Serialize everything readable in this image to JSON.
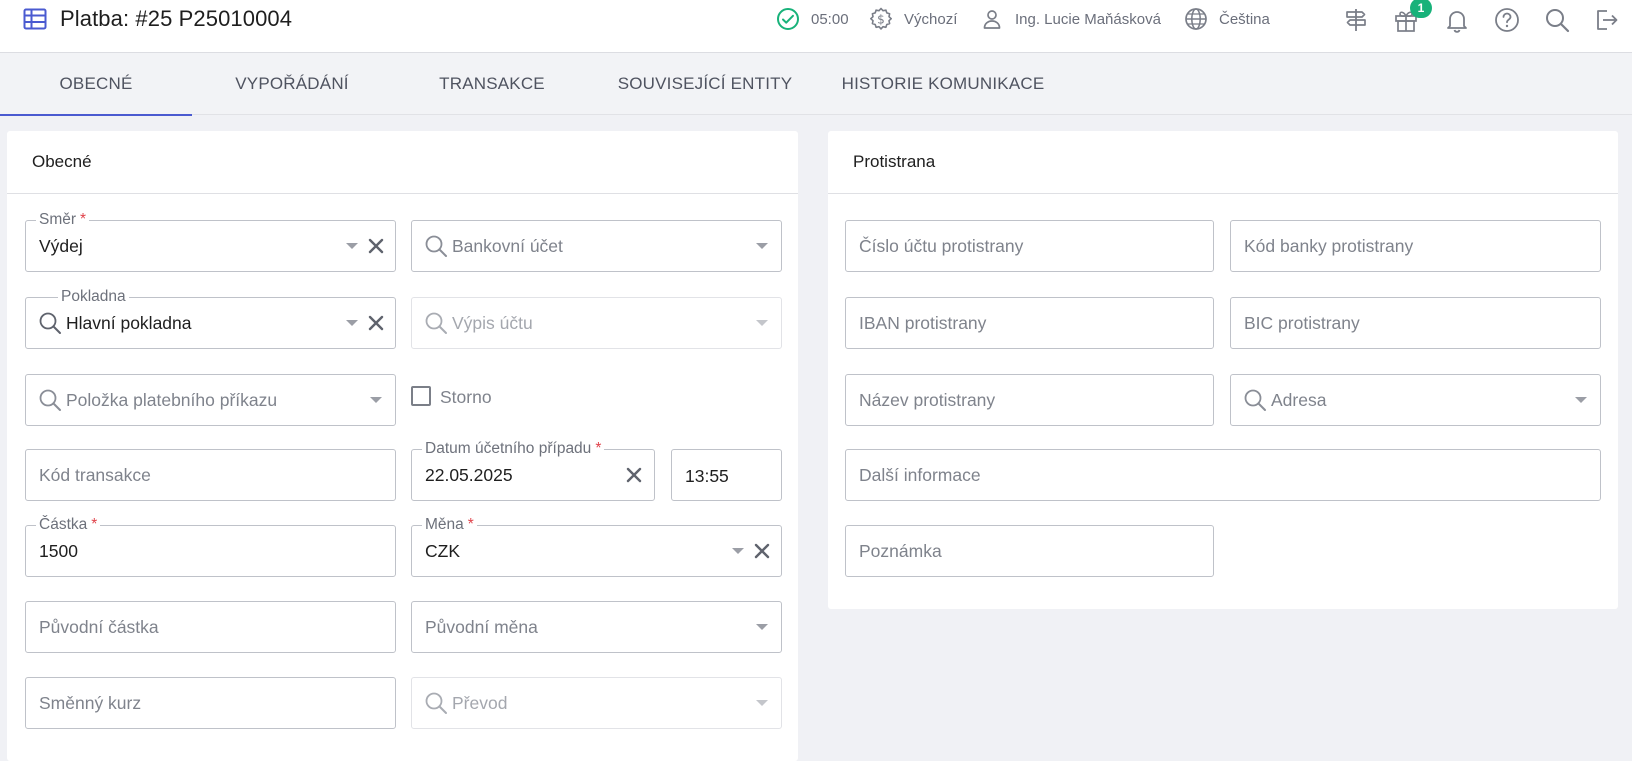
{
  "header": {
    "title": "Platba: #25 P25010004",
    "timer": "05:00",
    "profile": "Výchozí",
    "user": "Ing. Lucie Maňásková",
    "language": "Čeština",
    "gift_badge": "1",
    "accent_color": "#4a5ad0",
    "status_color": "#18b27a"
  },
  "tabs": [
    {
      "label": "OBECNÉ",
      "active": true
    },
    {
      "label": "VYPOŘÁDÁNÍ",
      "active": false
    },
    {
      "label": "TRANSAKCE",
      "active": false
    },
    {
      "label": "SOUVISEJÍCÍ ENTITY",
      "active": false
    },
    {
      "label": "HISTORIE KOMUNIKACE",
      "active": false
    }
  ],
  "general": {
    "title": "Obecné",
    "smer": {
      "label": "Směr",
      "value": "Výdej"
    },
    "bankovni_ucet": {
      "placeholder": "Bankovní účet"
    },
    "pokladna": {
      "label": "Pokladna",
      "value": "Hlavní pokladna"
    },
    "vypis_uctu": {
      "placeholder": "Výpis účtu"
    },
    "polozka": {
      "placeholder": "Položka platebního příkazu"
    },
    "storno": {
      "label": "Storno",
      "checked": false
    },
    "kod_transakce": {
      "placeholder": "Kód transakce"
    },
    "datum": {
      "label": "Datum účetního případu",
      "value": "22.05.2025"
    },
    "cas": {
      "value": "13:55"
    },
    "castka": {
      "label": "Částka",
      "value": "1500"
    },
    "mena": {
      "label": "Měna",
      "value": "CZK"
    },
    "puvodni_castka": {
      "placeholder": "Původní částka"
    },
    "puvodni_mena": {
      "placeholder": "Původní měna"
    },
    "smenny_kurz": {
      "placeholder": "Směnný kurz"
    },
    "prevod": {
      "placeholder": "Převod"
    },
    "required_mark": "*"
  },
  "counterparty": {
    "title": "Protistrana",
    "cislo_uctu": {
      "placeholder": "Číslo účtu protistrany"
    },
    "kod_banky": {
      "placeholder": "Kód banky protistrany"
    },
    "iban": {
      "placeholder": "IBAN protistrany"
    },
    "bic": {
      "placeholder": "BIC protistrany"
    },
    "nazev": {
      "placeholder": "Název protistrany"
    },
    "adresa": {
      "placeholder": "Adresa"
    },
    "dalsi_informace": {
      "placeholder": "Další informace"
    },
    "poznamka": {
      "placeholder": "Poznámka"
    }
  },
  "icons": {
    "title": "table-icon",
    "timer": "check-circle-icon",
    "profile": "dollar-gear-icon",
    "user": "user-icon",
    "language": "globe-icon",
    "signpost": "signpost-icon",
    "gift": "gift-icon",
    "notifications": "bell-icon",
    "help": "help-icon",
    "search": "search-icon",
    "logout": "logout-icon"
  }
}
